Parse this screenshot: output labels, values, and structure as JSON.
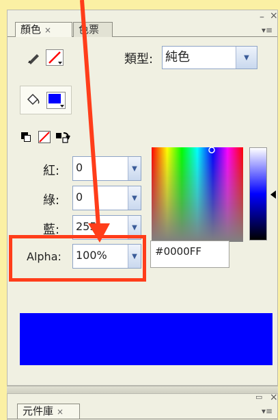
{
  "tabs": {
    "color": {
      "label": "顏色",
      "close": "×"
    },
    "swatches": {
      "label": "色票"
    },
    "library": {
      "label": "元件庫",
      "close": "×"
    }
  },
  "panel_controls": {
    "minimize": "–",
    "close": "×",
    "menu": "▾≡",
    "library_minimize": "▭",
    "library_close": "×"
  },
  "fill_type": {
    "label": "類型:",
    "value": "純色"
  },
  "channels": {
    "red": {
      "label": "紅:",
      "value": "0"
    },
    "green": {
      "label": "綠:",
      "value": "0"
    },
    "blue": {
      "label": "藍:",
      "value": "255"
    },
    "alpha": {
      "label": "Alpha:",
      "value": "100%"
    }
  },
  "hex": "#0000FF",
  "colors": {
    "stroke_color": "#ff0000",
    "fill_color": "#0000ff",
    "annotation": "#ff3d1a",
    "preview": "#0000ff"
  },
  "icons": {
    "stroke_tool": "pencil-icon",
    "fill_tool": "paint-bucket-icon",
    "default_colors": "black-white-icon",
    "no_color": "no-color-icon",
    "swap_colors": "swap-colors-icon",
    "dropdown": "chevron-down-icon"
  }
}
